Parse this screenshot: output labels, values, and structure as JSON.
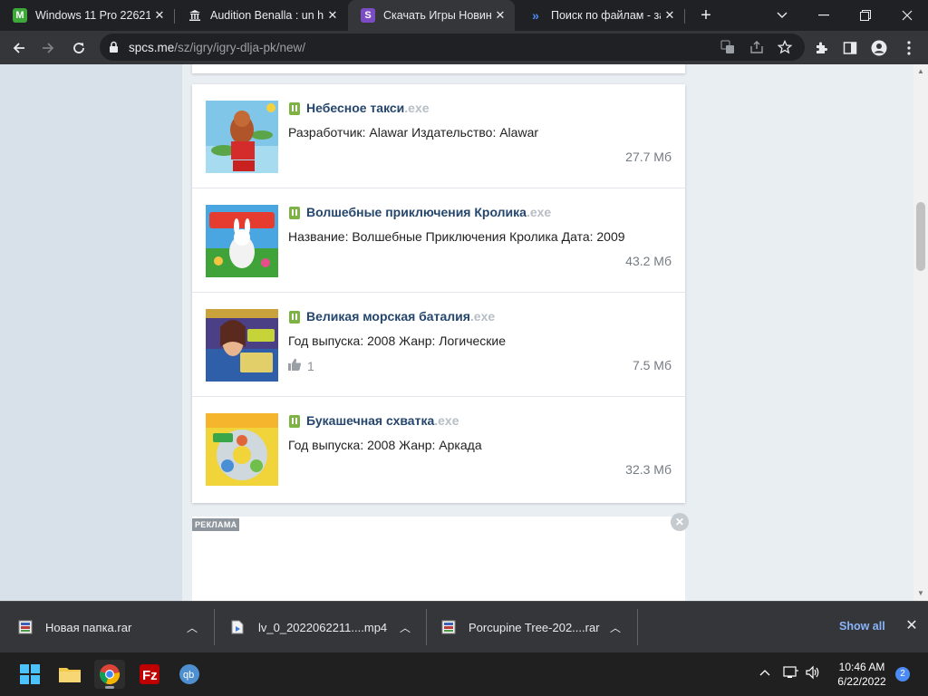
{
  "browser": {
    "tabs": [
      {
        "title": "Windows 11 Pro 22621",
        "icon": "m-green-icon"
      },
      {
        "title": "Audition Benalla : un h",
        "icon": "bank-icon"
      },
      {
        "title": "Скачать Игры Новинк",
        "icon": "s-purple-icon"
      },
      {
        "title": "Поиск по файлам - за",
        "icon": "chevrons-icon"
      }
    ],
    "url_host": "spcs.me",
    "url_path": "/sz/igry/igry-dlja-pk/new/"
  },
  "files": [
    {
      "name": "Небесное такси",
      "ext": ".exe",
      "desc": "Разработчик: Alawar Издательство: Alawar",
      "size": "27.7 Мб",
      "likes": null
    },
    {
      "name": "Волшебные приключения Кролика",
      "ext": ".exe",
      "desc": "Название: Волшебные Приключения Кролика Дата: 2009",
      "size": "43.2 Мб",
      "likes": null
    },
    {
      "name": "Великая морская баталия",
      "ext": ".exe",
      "desc": "Год выпуска: 2008 Жанр: Логические",
      "size": "7.5 Мб",
      "likes": "1"
    },
    {
      "name": "Букашечная схватка",
      "ext": ".exe",
      "desc": "Год выпуска: 2008 Жанр: Аркада",
      "size": "32.3 Мб",
      "likes": null
    }
  ],
  "ad": {
    "label": "РЕКЛАМА"
  },
  "downloads": {
    "items": [
      {
        "name": "Новая папка.rar"
      },
      {
        "name": "lv_0_2022062211....mp4"
      },
      {
        "name": "Porcupine Tree-202....rar"
      }
    ],
    "show_all": "Show all"
  },
  "taskbar": {
    "time": "10:46 AM",
    "date": "6/22/2022",
    "notifications": "2"
  },
  "colors": {
    "accent_link": "#25466d",
    "download_link": "#8ab4f8"
  }
}
